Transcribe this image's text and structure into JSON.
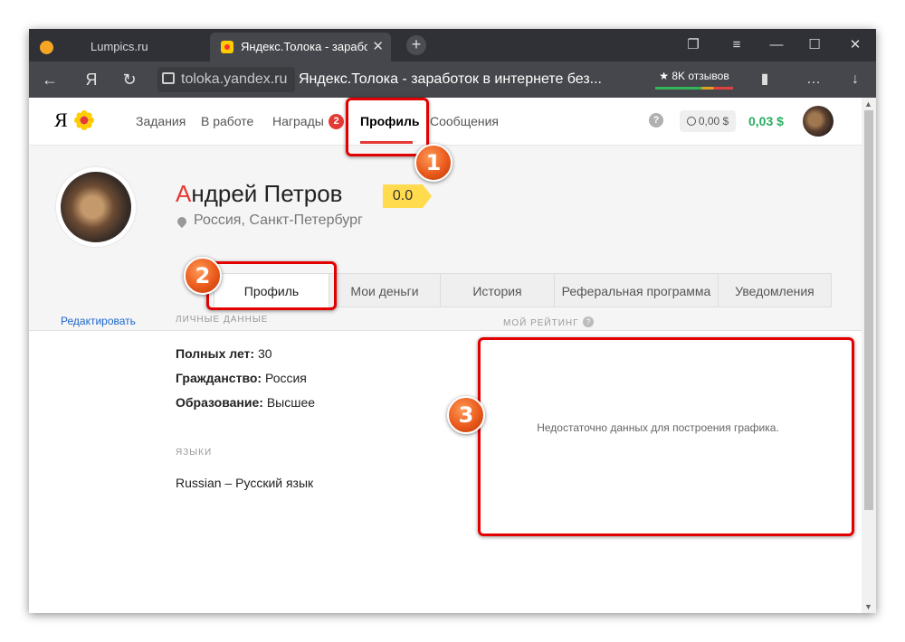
{
  "browser": {
    "tabs": [
      {
        "title": "Lumpics.ru"
      },
      {
        "title": "Яндекс.Толока - заработок"
      }
    ],
    "new_tab": "+",
    "tab_close": "✕",
    "domain": "toloka.yandex.ru",
    "page_title": "Яндекс.Толока - заработок в интернете без...",
    "reviews": "★ 8K отзывов",
    "back": "←",
    "yandex": "Я",
    "reload": "↻",
    "menu": "…",
    "download": "↓"
  },
  "header": {
    "logo": "Я",
    "nav": [
      {
        "label": "Задания"
      },
      {
        "label": "В работе"
      },
      {
        "label": "Награды"
      },
      {
        "label": "Профиль"
      },
      {
        "label": "Сообщения"
      }
    ],
    "rewards_badge": "2",
    "help": "?",
    "balance_pending": "0,00 $",
    "balance": "0,03 $"
  },
  "profile": {
    "name_first_letter": "А",
    "name_rest": "ндрей Петров",
    "rating": "0.0",
    "location": "Россия, Санкт-Петербург",
    "tabs": [
      {
        "label": "Профиль"
      },
      {
        "label": "Мои деньги"
      },
      {
        "label": "История"
      },
      {
        "label": "Реферальная программа"
      },
      {
        "label": "Уведомления"
      }
    ]
  },
  "content": {
    "edit_link": "Редактировать",
    "personal_title": "личные данные",
    "age_label": "Полных лет:",
    "age_value": " 30",
    "citizenship_label": "Гражданство:",
    "citizenship_value": " Россия",
    "education_label": "Образование:",
    "education_value": " Высшее",
    "languages_title": "языки",
    "language": "Russian – Русский язык",
    "rating_title": "мой рейтинг",
    "rating_help": "?",
    "no_data": "Недостаточно данных для построения графика."
  },
  "annotations": {
    "markers": [
      "1",
      "2",
      "3"
    ],
    "highlight_color": "#e30000",
    "marker_color": "#ea5a1c"
  }
}
